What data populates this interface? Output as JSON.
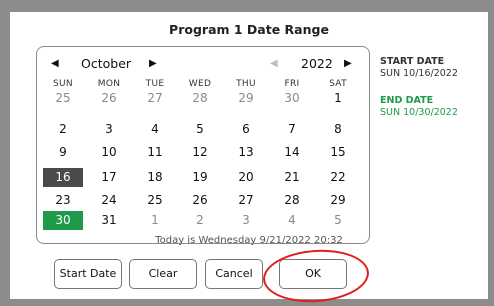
{
  "dialog": {
    "title": "Program 1 Date Range"
  },
  "calendar": {
    "prev_month_icon": "triangle-left",
    "month": "October",
    "next_month_icon": "triangle-right",
    "prev_year_icon": "triangle-left-disabled",
    "year": "2022",
    "next_year_icon": "triangle-right",
    "weekdays": [
      "SUN",
      "MON",
      "TUE",
      "WED",
      "THU",
      "FRI",
      "SAT"
    ],
    "weeks": [
      [
        "25",
        "26",
        "27",
        "28",
        "29",
        "30",
        "1"
      ],
      [
        "2",
        "3",
        "4",
        "5",
        "6",
        "7",
        "8"
      ],
      [
        "9",
        "10",
        "11",
        "12",
        "13",
        "14",
        "15"
      ],
      [
        "16",
        "17",
        "18",
        "19",
        "20",
        "21",
        "22"
      ],
      [
        "23",
        "24",
        "25",
        "26",
        "27",
        "28",
        "29"
      ],
      [
        "30",
        "31",
        "1",
        "2",
        "3",
        "4",
        "5"
      ]
    ],
    "today_text": "Today is Wednesday  9/21/2022  20:32"
  },
  "summary": {
    "start_label": "START DATE",
    "start_value": "SUN 10/16/2022",
    "end_label": "END DATE",
    "end_value": "SUN 10/30/2022",
    "end_color": "#1e9a4a"
  },
  "buttons": {
    "start_date": "Start Date",
    "clear": "Clear",
    "cancel": "Cancel",
    "ok": "OK"
  },
  "colors": {
    "start_highlight": "#4a4a4a",
    "end_highlight": "#1e9a4a",
    "annotation_ring": "#e21d1d"
  }
}
